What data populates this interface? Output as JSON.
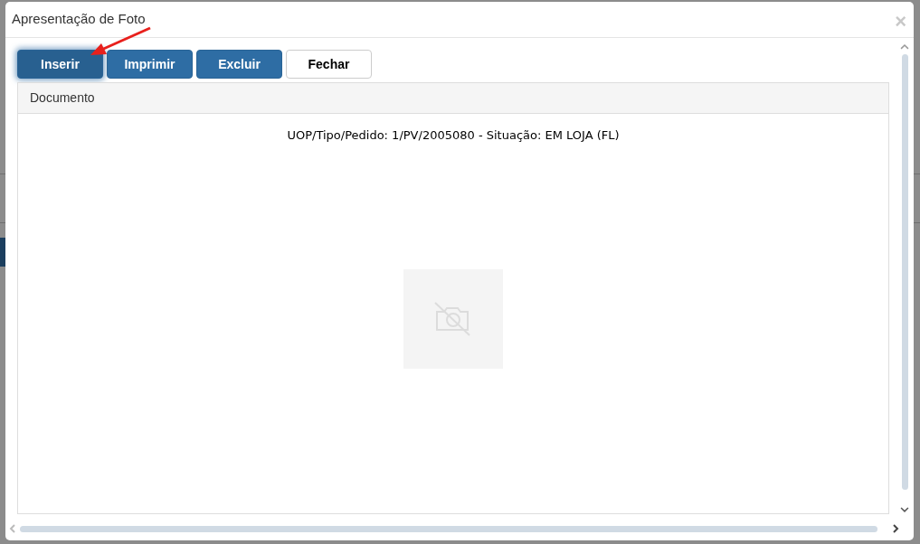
{
  "dialog": {
    "title": "Apresentação de Foto",
    "close": "×"
  },
  "buttons": [
    {
      "label": "Inserir",
      "kind": "primary",
      "focused": true
    },
    {
      "label": "Imprimir",
      "kind": "primary",
      "focused": false
    },
    {
      "label": "Excluir",
      "kind": "primary",
      "focused": false
    },
    {
      "label": "Fechar",
      "kind": "default",
      "focused": false
    }
  ],
  "panel": {
    "heading": "Documento",
    "caption": "UOP/Tipo/Pedido: 1/PV/2005080 - Situação: EM LOJA (FL)"
  }
}
